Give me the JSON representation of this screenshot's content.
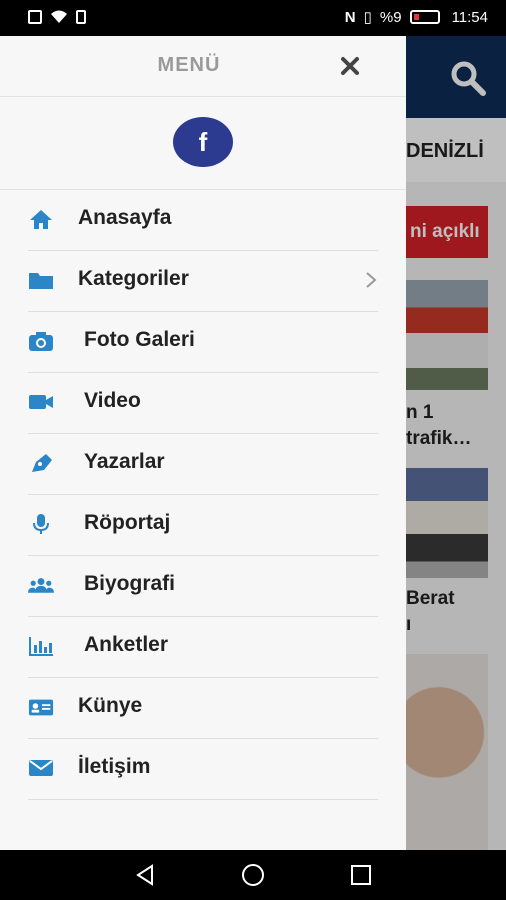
{
  "status_bar": {
    "battery_percent": "%9",
    "time": "11:54"
  },
  "background": {
    "city_tab": "DENİZLİ",
    "live_badge": "ni açıklı",
    "headline1_line1": "n 1",
    "headline1_line2": "trafik…",
    "headline2_line1": "Berat",
    "headline2_line2": "ı"
  },
  "drawer": {
    "title": "MENÜ",
    "facebook_label": "f",
    "items": [
      {
        "label": "Anasayfa",
        "icon": "home-icon"
      },
      {
        "label": "Kategoriler",
        "icon": "folder-icon",
        "has_submenu": true
      },
      {
        "label": "Foto Galeri",
        "icon": "camera-icon"
      },
      {
        "label": "Video",
        "icon": "video-camera-icon"
      },
      {
        "label": "Yazarlar",
        "icon": "pen-icon"
      },
      {
        "label": "Röportaj",
        "icon": "microphone-icon"
      },
      {
        "label": "Biyografi",
        "icon": "users-icon"
      },
      {
        "label": "Anketler",
        "icon": "bar-chart-icon"
      },
      {
        "label": "Künye",
        "icon": "id-card-icon"
      },
      {
        "label": "İletişim",
        "icon": "envelope-icon"
      }
    ]
  },
  "colors": {
    "accent_blue": "#2a86c6",
    "header_navy": "#0f2c57",
    "facebook_blue": "#2c3a8f",
    "live_red": "#d32027"
  }
}
